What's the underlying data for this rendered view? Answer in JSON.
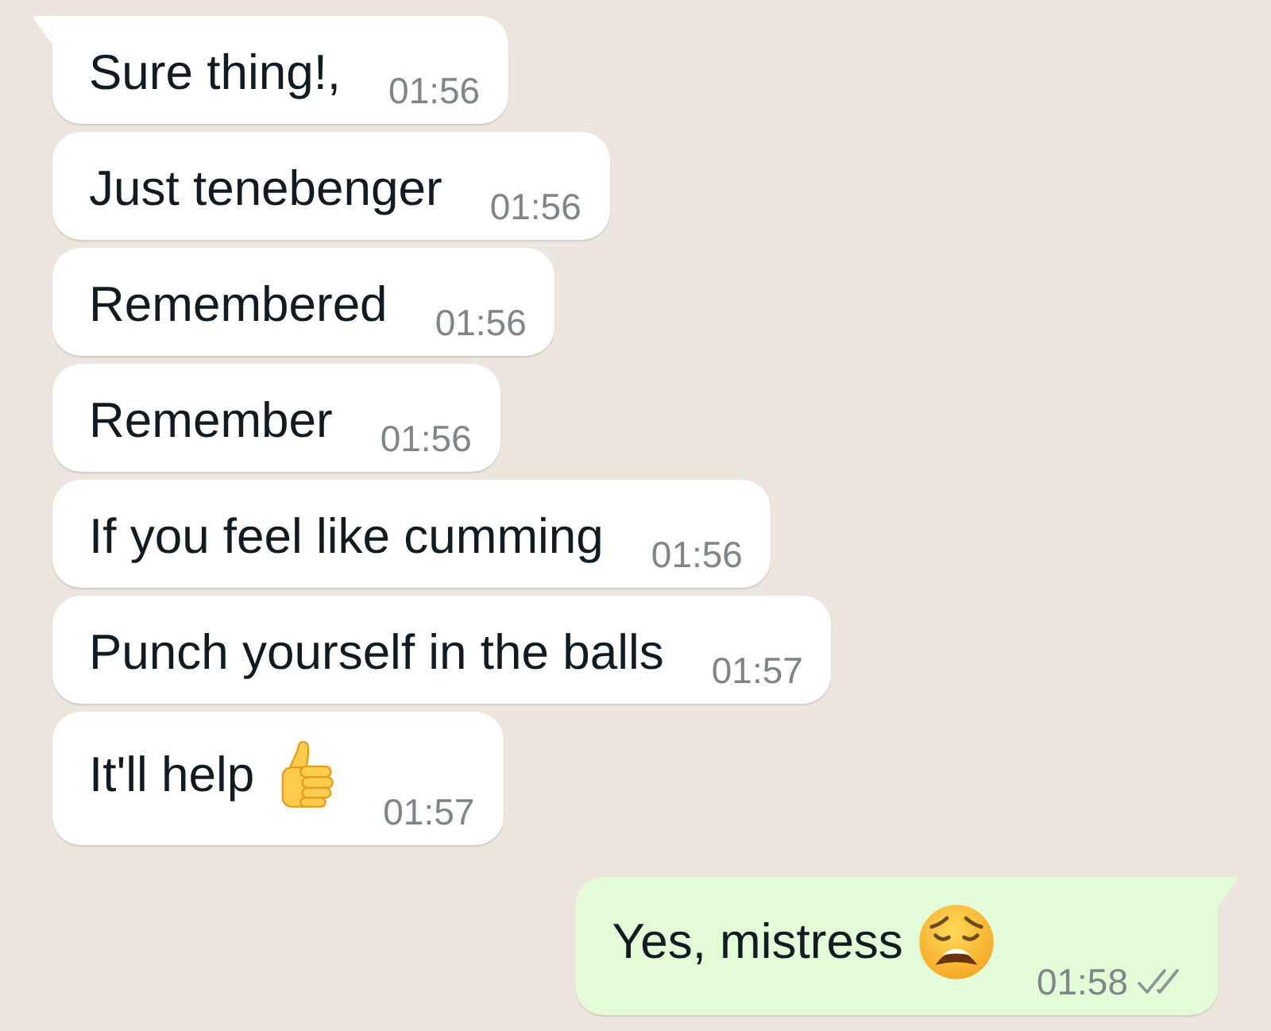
{
  "messages": [
    {
      "outgoing": false,
      "tail": true,
      "kind": "plain",
      "text": "Sure thing!,",
      "time": "01:56"
    },
    {
      "outgoing": false,
      "tail": false,
      "kind": "plain",
      "text": "Just tenebenger",
      "time": "01:56"
    },
    {
      "outgoing": false,
      "tail": false,
      "kind": "plain",
      "text": "Remembered",
      "time": "01:56"
    },
    {
      "outgoing": false,
      "tail": false,
      "kind": "plain",
      "text": "Remember",
      "time": "01:56"
    },
    {
      "outgoing": false,
      "tail": false,
      "kind": "plain",
      "text": "If you feel like cumming",
      "time": "01:56"
    },
    {
      "outgoing": false,
      "tail": false,
      "kind": "plain",
      "text": "Punch yourself in the balls",
      "time": "01:57"
    },
    {
      "outgoing": false,
      "tail": false,
      "kind": "thumbsup",
      "text": "It'll help",
      "time": "01:57"
    },
    {
      "outgoing": true,
      "tail": true,
      "kind": "weary",
      "text": "Yes, mistress",
      "time": "01:58",
      "read": false
    }
  ]
}
